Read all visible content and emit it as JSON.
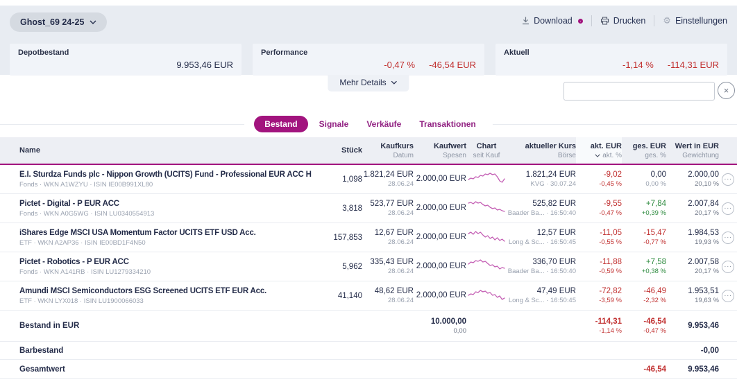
{
  "header": {
    "portfolio_label": "Ghost_69 24-25",
    "actions": {
      "download": "Download",
      "print": "Drucken",
      "settings": "Einstellungen"
    },
    "cards": [
      {
        "label": "Depotbestand",
        "value": "9.953,46 EUR"
      },
      {
        "label": "Performance",
        "pct": "-0,47 %",
        "value": "-46,54 EUR"
      },
      {
        "label": "Aktuell",
        "pct": "-1,14 %",
        "value": "-114,31 EUR"
      }
    ],
    "more_details": "Mehr Details"
  },
  "search": {
    "value": "",
    "placeholder": ""
  },
  "tabs": {
    "items": [
      "Bestand",
      "Signale",
      "Verkäufe",
      "Transaktionen"
    ],
    "active": "Bestand"
  },
  "table": {
    "columns": {
      "name": "Name",
      "stueck": "Stück",
      "kaufkurs": "Kaufkurs",
      "kaufkurs_sub": "Datum",
      "kaufwert": "Kaufwert",
      "kaufwert_sub": "Spesen",
      "chart": "Chart",
      "chart_sub": "seit Kauf",
      "kurs": "aktueller Kurs",
      "kurs_sub": "Börse",
      "akt": "akt. EUR",
      "akt_sub": "akt. %",
      "ges": "ges. EUR",
      "ges_sub": "ges. %",
      "wert": "Wert in EUR",
      "wert_sub": "Gewichtung"
    },
    "rows": [
      {
        "name": "E.I. Sturdza Funds plc - Nippon Growth (UCITS) Fund - Professional EUR ACC H",
        "meta": "Fonds · WKN A1WZYU · ISIN IE00B991XL80",
        "stueck": "1,098",
        "kaufkurs": "1.821,24 EUR",
        "kaufdatum": "28.06.24",
        "kaufwert": "2.000,00 EUR",
        "spesen": "",
        "kurs": "1.821,24 EUR",
        "boerse": "KVG · 30.07.24",
        "akt_eur": "-9,02",
        "akt_pct": "-0,45 %",
        "akt_tone": "neg",
        "ges_eur": "0,00",
        "ges_pct": "0,00 %",
        "ges_tone": "flat",
        "wert": "2.000,00",
        "gewichtung": "20,10 %",
        "sparkline": [
          13,
          11,
          12,
          9,
          10,
          7,
          8,
          5,
          6,
          4,
          6,
          5,
          9,
          15,
          17,
          12
        ]
      },
      {
        "name": "Pictet - Digital - P EUR ACC",
        "meta": "Fonds · WKN A0G5WG · ISIN LU0340554913",
        "stueck": "3,818",
        "kaufkurs": "523,77 EUR",
        "kaufdatum": "28.06.24",
        "kaufwert": "2.000,00 EUR",
        "spesen": "",
        "kurs": "525,82 EUR",
        "boerse": "Baader Ba... · 16:50:40",
        "akt_eur": "-9,55",
        "akt_pct": "-0,47 %",
        "akt_tone": "neg",
        "ges_eur": "+7,84",
        "ges_pct": "+0,39 %",
        "ges_tone": "pos",
        "wert": "2.007,84",
        "gewichtung": "20,17 %",
        "sparkline": [
          5,
          4,
          6,
          3,
          5,
          4,
          7,
          9,
          8,
          11,
          13,
          12,
          15,
          14,
          16,
          17
        ]
      },
      {
        "name": "iShares Edge MSCI USA Momentum Factor UCITS ETF USD Acc.",
        "meta": "ETF · WKN A2AP36 · ISIN IE00BD1F4N50",
        "stueck": "157,853",
        "kaufkurs": "12,67 EUR",
        "kaufdatum": "28.06.24",
        "kaufwert": "2.000,00 EUR",
        "spesen": "",
        "kurs": "12,57 EUR",
        "boerse": "Long & Sc... · 16:50:45",
        "akt_eur": "-11,05",
        "akt_pct": "-0,55 %",
        "akt_tone": "neg",
        "ges_eur": "-15,47",
        "ges_pct": "-0,77 %",
        "ges_tone": "neg",
        "wert": "1.984,53",
        "gewichtung": "19,93 %",
        "sparkline": [
          7,
          5,
          8,
          4,
          7,
          5,
          9,
          12,
          10,
          14,
          12,
          16,
          13,
          17,
          15,
          18
        ]
      },
      {
        "name": "Pictet - Robotics - P EUR ACC",
        "meta": "Fonds · WKN A141RB · ISIN LU1279334210",
        "stueck": "5,962",
        "kaufkurs": "335,43 EUR",
        "kaufdatum": "28.06.24",
        "kaufwert": "2.000,00 EUR",
        "spesen": "",
        "kurs": "336,70 EUR",
        "boerse": "Baader Ba... · 16:50:40",
        "akt_eur": "-11,88",
        "akt_pct": "-0,59 %",
        "akt_tone": "neg",
        "ges_eur": "+7,58",
        "ges_pct": "+0,38 %",
        "ges_tone": "pos",
        "wert": "2.007,58",
        "gewichtung": "20,17 %",
        "sparkline": [
          9,
          6,
          7,
          4,
          5,
          3,
          6,
          5,
          8,
          11,
          10,
          13,
          12,
          16,
          14,
          15
        ]
      },
      {
        "name": "Amundi MSCI Semiconductors ESG Screened UCITS ETF EUR Acc.",
        "meta": "ETF · WKN LYX018 · ISIN LU1900066033",
        "stueck": "41,140",
        "kaufkurs": "48,62 EUR",
        "kaufdatum": "28.06.24",
        "kaufwert": "2.000,00 EUR",
        "spesen": "",
        "kurs": "47,49 EUR",
        "boerse": "Long & Sc... · 16:50:45",
        "akt_eur": "-72,82",
        "akt_pct": "-3,59 %",
        "akt_tone": "neg",
        "ges_eur": "-46,49",
        "ges_pct": "-2,32 %",
        "ges_tone": "neg",
        "wert": "1.953,51",
        "gewichtung": "19,63 %",
        "sparkline": [
          12,
          10,
          11,
          7,
          8,
          5,
          7,
          6,
          9,
          8,
          12,
          11,
          15,
          13,
          18,
          16
        ]
      }
    ],
    "footer": {
      "bestand": {
        "label": "Bestand in EUR",
        "kaufwert": "10.000,00",
        "spesen": "0,00",
        "akt": "-114,31",
        "akt_pct": "-1,14 %",
        "ges": "-46,54",
        "ges_pct": "-0,47 %",
        "wert": "9.953,46"
      },
      "barbestand": {
        "label": "Barbestand",
        "wert": "-0,00"
      },
      "gesamt": {
        "label": "Gesamtwert",
        "ges": "-46,54",
        "wert": "9.953,46"
      }
    }
  },
  "colors": {
    "accent": "#a2147e",
    "negative": "#c13030",
    "positive": "#2e8b3f",
    "sparkline": "#c45fb4"
  }
}
